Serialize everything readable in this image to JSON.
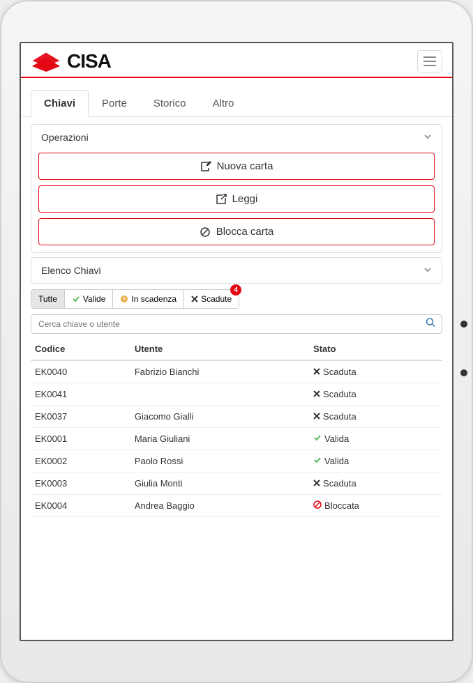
{
  "brand": "CISA",
  "tabs": [
    {
      "label": "Chiavi",
      "active": true
    },
    {
      "label": "Porte",
      "active": false
    },
    {
      "label": "Storico",
      "active": false
    },
    {
      "label": "Altro",
      "active": false
    }
  ],
  "accordion_ops": {
    "title": "Operazioni",
    "buttons": [
      {
        "label": "Nuova carta",
        "icon": "edit"
      },
      {
        "label": "Leggi",
        "icon": "open"
      },
      {
        "label": "Blocca carta",
        "icon": "block"
      }
    ]
  },
  "accordion_list": {
    "title": "Elenco Chiavi",
    "filters": [
      {
        "label": "Tutte",
        "icon": null,
        "active": true
      },
      {
        "label": "Valide",
        "icon": "check-green",
        "active": false
      },
      {
        "label": "In scadenza",
        "icon": "clock-amber",
        "active": false
      },
      {
        "label": "Scadute",
        "icon": "x-dark",
        "active": false,
        "badge": "4"
      }
    ],
    "search_placeholder": "Cerca chiave o utente",
    "columns": [
      "Codice",
      "Utente",
      "Stato"
    ],
    "rows": [
      {
        "code": "EK0040",
        "user": "Fabrizio Bianchi",
        "status": "Scaduta",
        "status_icon": "x"
      },
      {
        "code": "EK0041",
        "user": "",
        "status": "Scaduta",
        "status_icon": "x"
      },
      {
        "code": "EK0037",
        "user": "Giacomo Gialli",
        "status": "Scaduta",
        "status_icon": "x"
      },
      {
        "code": "EK0001",
        "user": "Maria Giuliani",
        "status": "Valida",
        "status_icon": "check"
      },
      {
        "code": "EK0002",
        "user": "Paolo Rossi",
        "status": "Valida",
        "status_icon": "check"
      },
      {
        "code": "EK0003",
        "user": "Giulia Monti",
        "status": "Scaduta",
        "status_icon": "x"
      },
      {
        "code": "EK0004",
        "user": "Andrea Baggio",
        "status": "Bloccata",
        "status_icon": "block"
      }
    ]
  }
}
